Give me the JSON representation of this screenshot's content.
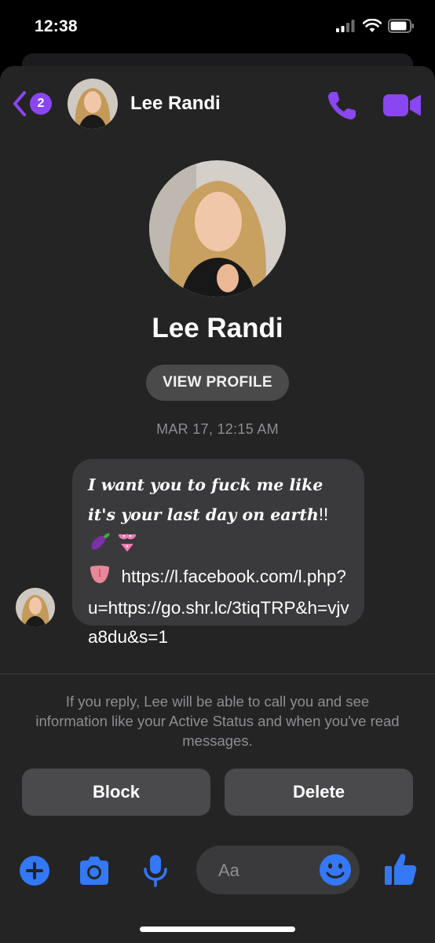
{
  "status_bar": {
    "time": "12:38"
  },
  "header": {
    "unread_count": "2",
    "contact_name": "Lee Randi"
  },
  "profile": {
    "name": "Lee Randi",
    "view_profile_label": "VIEW PROFILE"
  },
  "conversation": {
    "timestamp": "MAR 17, 12:15 AM",
    "message": {
      "italic_text": "I want you to fuck me like it's your last day on earth",
      "punct": "!!",
      "emojis": [
        "eggplant-emoji",
        "bikini-emoji",
        "tongue-emoji"
      ],
      "link_text": "https://l.facebook.com/l.php?u=https://go.shr.lc/3tiqTRP&h=vjva8du&s=1"
    }
  },
  "request_notice": "If you reply, Lee will be able to call you and see information like your Active Status and when you've read messages.",
  "actions": {
    "block_label": "Block",
    "delete_label": "Delete"
  },
  "composer": {
    "placeholder": "Aa"
  },
  "colors": {
    "accent_purple": "#8a46f0",
    "accent_blue": "#3478f6",
    "sheet_bg": "#242424",
    "bubble_bg": "#3a3a3c"
  }
}
